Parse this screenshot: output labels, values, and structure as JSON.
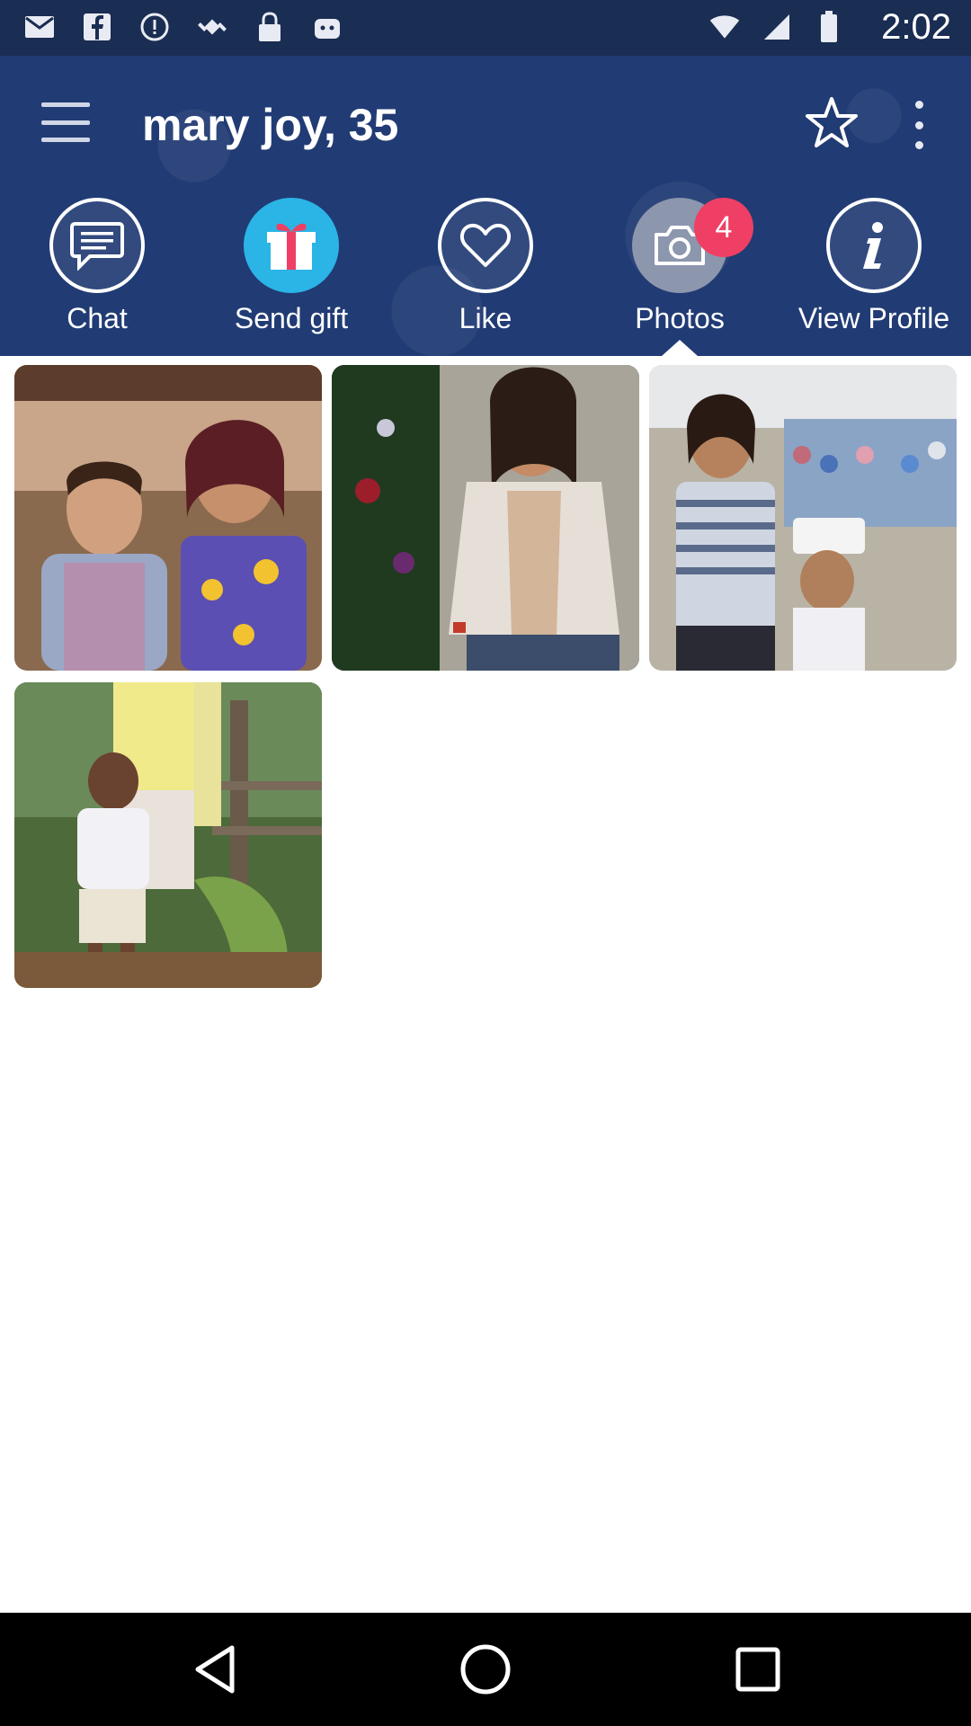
{
  "status_bar": {
    "time": "2:02",
    "icons": [
      "mail-icon",
      "facebook-icon",
      "alert-icon",
      "fake-gps-icon",
      "lock-icon",
      "android-icon",
      "wifi-icon",
      "signal-icon",
      "battery-icon"
    ]
  },
  "toolbar": {
    "title": "mary joy, 35",
    "menu_icon": "hamburger-menu-icon",
    "favorite_icon": "star-icon",
    "more_icon": "more-vertical-icon"
  },
  "actions": [
    {
      "label": "Chat",
      "icon": "chat-bubble-icon"
    },
    {
      "label": "Send gift",
      "icon": "gift-icon"
    },
    {
      "label": "Like",
      "icon": "heart-icon"
    },
    {
      "label": "Photos",
      "icon": "camera-icon",
      "badge": "4"
    },
    {
      "label": "View Profile",
      "icon": "info-icon"
    }
  ],
  "photos_count": 4,
  "colors": {
    "header_bg": "#213b74",
    "accent_gift": "#2bb4e6",
    "badge": "#ef3f64"
  },
  "navbar": {
    "icons": [
      "back-icon",
      "home-icon",
      "recents-icon"
    ]
  }
}
